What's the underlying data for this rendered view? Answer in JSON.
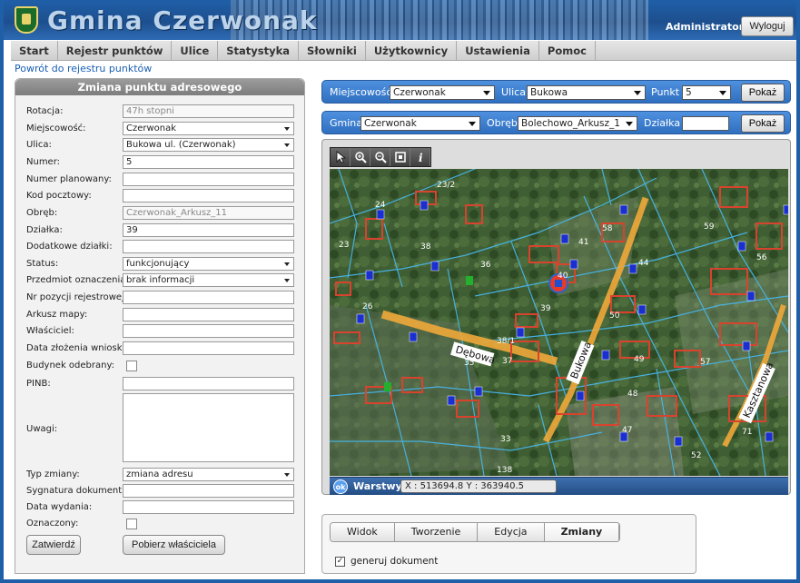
{
  "app": {
    "title": "Gmina Czerwonak",
    "user": "Administrator",
    "logout_label": "Wyloguj"
  },
  "nav": {
    "items": [
      "Start",
      "Rejestr punktów",
      "Ulice",
      "Statystyka",
      "Słowniki",
      "Użytkownicy",
      "Ustawienia",
      "Pomoc"
    ]
  },
  "back_link": "Powrót do rejestru punktów",
  "form": {
    "title": "Zmiana punktu adresowego",
    "fields": [
      {
        "label": "Rotacja:",
        "value": "47h stopni"
      },
      {
        "label": "Miejscowość:",
        "value": "Czerwonak"
      },
      {
        "label": "Ulica:",
        "value": "Bukowa ul. (Czerwonak)"
      },
      {
        "label": "Numer:",
        "value": "5"
      },
      {
        "label": "Numer planowany:",
        "value": ""
      },
      {
        "label": "Kod pocztowy:",
        "value": ""
      },
      {
        "label": "Obręb:",
        "value": "Czerwonak_Arkusz_11"
      },
      {
        "label": "Działka:",
        "value": "39"
      },
      {
        "label": "Dodatkowe działki:",
        "value": ""
      },
      {
        "label": "Status:",
        "value": "funkcjonujący"
      },
      {
        "label": "Przedmiot oznaczenia:",
        "value": "brak informacji"
      },
      {
        "label": "Nr pozycji rejestrowej:",
        "value": ""
      },
      {
        "label": "Arkusz mapy:",
        "value": ""
      },
      {
        "label": "Właściciel:",
        "value": ""
      },
      {
        "label": "Data złożenia wniosku:",
        "value": ""
      },
      {
        "label": "Budynek odebrany:",
        "value": ""
      },
      {
        "label": "PINB:",
        "value": ""
      },
      {
        "label": "Uwagi:",
        "value": ""
      },
      {
        "label": "Typ zmiany:",
        "value": "zmiana adresu"
      },
      {
        "label": "Sygnatura dokumentu:",
        "value": ""
      },
      {
        "label": "Data wydania:",
        "value": ""
      },
      {
        "label": "Oznaczony:",
        "value": ""
      }
    ],
    "confirm_label": "Zatwierdź",
    "fetch_owner_label": "Pobierz właściciela"
  },
  "query_bar_1": {
    "locality_label": "Miejscowość",
    "locality_value": "Czerwonak",
    "street_label": "Ulica",
    "street_value": "Bukowa",
    "point_label": "Punkt",
    "point_value": "5",
    "show_label": "Pokaż"
  },
  "query_bar_2": {
    "commune_label": "Gmina",
    "commune_value": "Czerwonak",
    "precinct_label": "Obręb",
    "precinct_value": "Bolechowo_Arkusz_1",
    "parcel_label": "Działka",
    "show_label": "Pokaż"
  },
  "map": {
    "streets": [
      "Dębowa",
      "Bukowa",
      "Kasztanowa"
    ],
    "parcel_numbers": [
      "23/2",
      "24",
      "23",
      "26",
      "36",
      "38",
      "41",
      "40",
      "39",
      "44",
      "58",
      "59",
      "50",
      "49",
      "56",
      "57",
      "48",
      "37",
      "38/1",
      "35",
      "33",
      "47",
      "52",
      "71",
      "138"
    ],
    "layers_icon_text": "ok",
    "layers_label": "Warstwy",
    "coordinates": "X : 513694.8  Y : 363940.5"
  },
  "tabs": {
    "items": [
      "Widok",
      "Tworzenie",
      "Edycja",
      "Zmiany"
    ],
    "active": "Zmiany",
    "generate_label": "generuj dokument",
    "generate_checked": "✓"
  }
}
